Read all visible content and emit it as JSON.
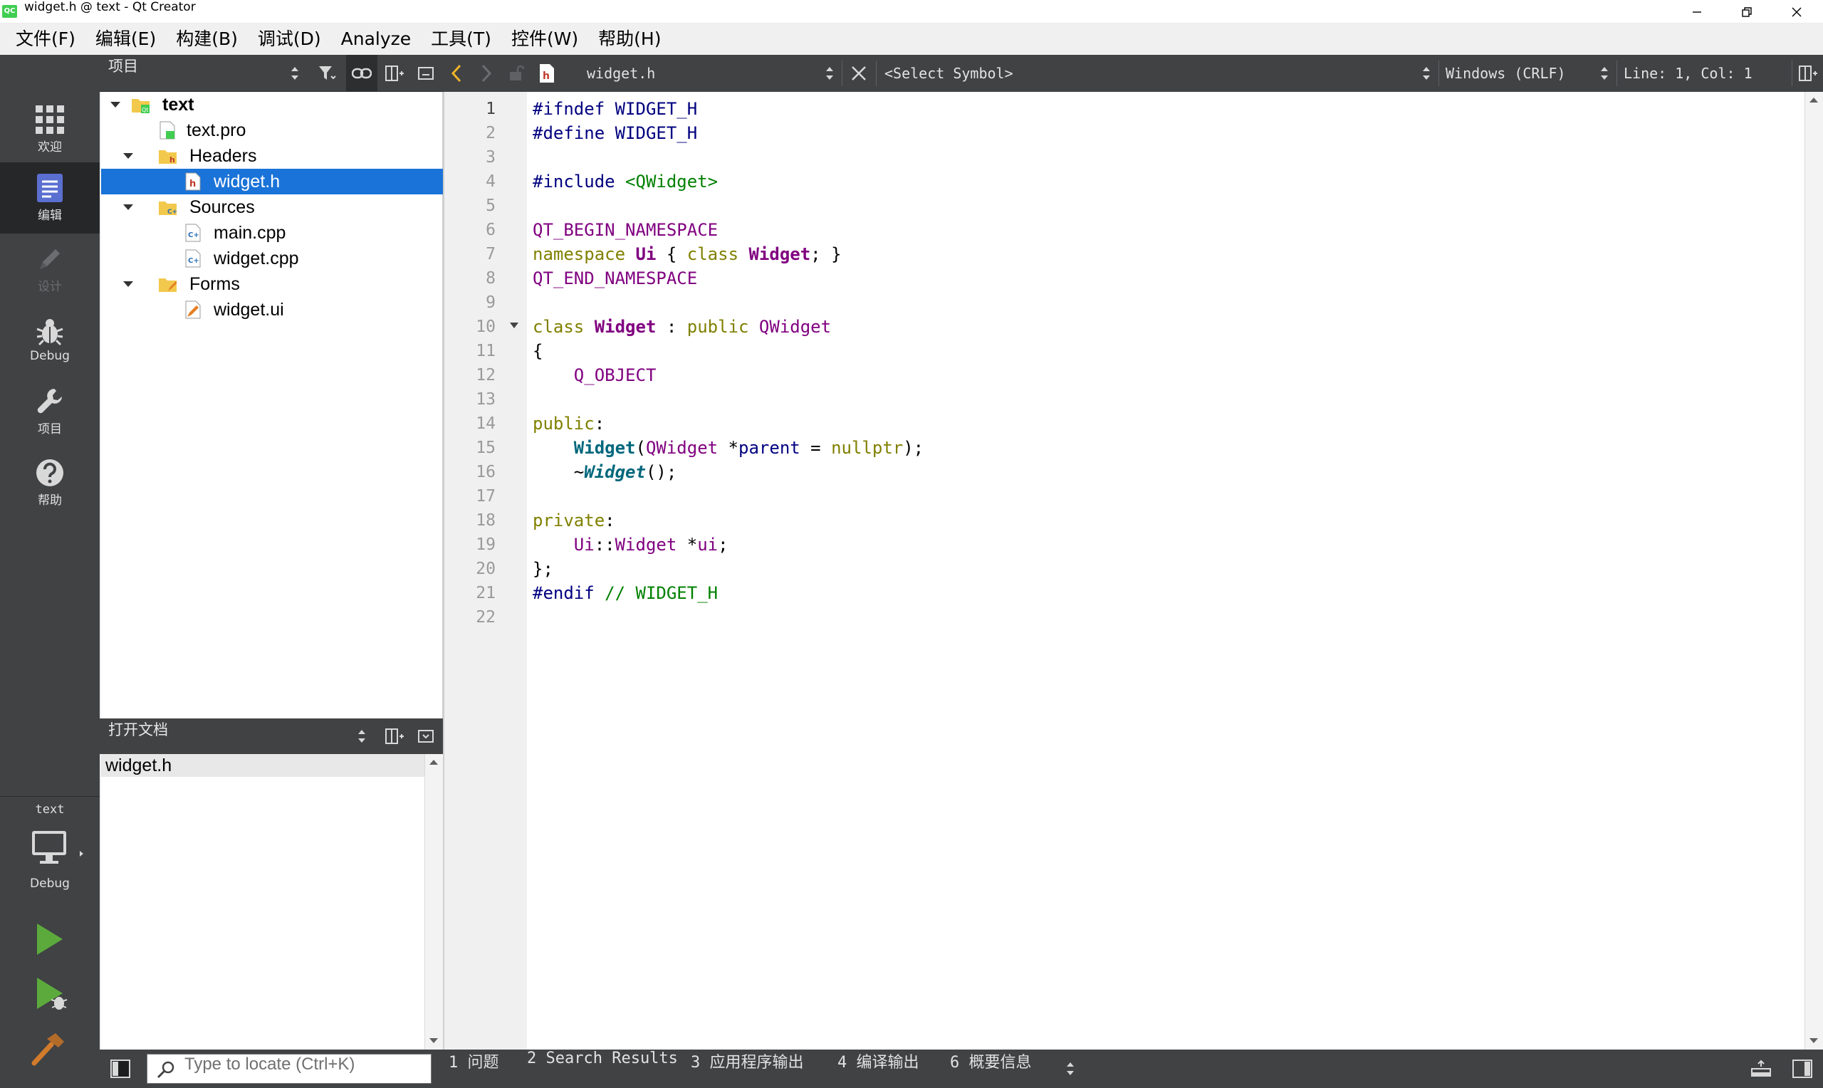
{
  "window": {
    "title": "widget.h @ text - Qt Creator",
    "app_icon_text": "QC"
  },
  "menu": [
    "文件(F)",
    "编辑(E)",
    "构建(B)",
    "调试(D)",
    "Analyze",
    "工具(T)",
    "控件(W)",
    "帮助(H)"
  ],
  "modes": {
    "welcome": "欢迎",
    "edit": "编辑",
    "design": "设计",
    "debug": "Debug",
    "projects": "项目",
    "help": "帮助",
    "kit_project": "text",
    "kit_build": "Debug"
  },
  "project_panel": {
    "title": "项目",
    "tree": {
      "root": "text",
      "pro_file": "text.pro",
      "headers": "Headers",
      "header_file": "widget.h",
      "sources": "Sources",
      "source_main": "main.cpp",
      "source_widget": "widget.cpp",
      "forms": "Forms",
      "form_file": "widget.ui"
    }
  },
  "open_docs": {
    "title": "打开文档",
    "items": [
      "widget.h"
    ]
  },
  "editor_toolbar": {
    "file": "widget.h",
    "symbol": "<Select Symbol>",
    "line_ending": "Windows (CRLF)",
    "position": "Line: 1, Col: 1"
  },
  "editor": {
    "current_line": 1,
    "line_numbers": [
      "1",
      "2",
      "3",
      "4",
      "5",
      "6",
      "7",
      "8",
      "9",
      "10",
      "11",
      "12",
      "13",
      "14",
      "15",
      "16",
      "17",
      "18",
      "19",
      "20",
      "21",
      "22"
    ],
    "code_tokens": {
      "l1": "#ifndef WIDGET_H",
      "l2": "#define WIDGET_H",
      "l4a": "#include ",
      "l4b": "<QWidget>",
      "l6": "QT_BEGIN_NAMESPACE",
      "l7a": "namespace ",
      "l7b": "Ui",
      "l7c": " { ",
      "l7d": "class ",
      "l7e": "Widget",
      "l7f": "; }",
      "l8": "QT_END_NAMESPACE",
      "l10a": "class ",
      "l10b": "Widget",
      "l10c": " : ",
      "l10d": "public ",
      "l10e": "QWidget",
      "l11": "{",
      "l12": "    Q_OBJECT",
      "l14a": "public",
      "l14b": ":",
      "l15a": "    ",
      "l15b": "Widget",
      "l15c": "(",
      "l15d": "QWidget",
      "l15e": " *",
      "l15f": "parent",
      "l15g": " = ",
      "l15h": "nullptr",
      "l15i": ");",
      "l16a": "    ~",
      "l16b": "Widget",
      "l16c": "();",
      "l18a": "private",
      "l18b": ":",
      "l19a": "    ",
      "l19b": "Ui",
      "l19c": "::",
      "l19d": "Widget",
      "l19e": " *",
      "l19f": "ui",
      "l19g": ";",
      "l20": "};",
      "l21a": "#endif",
      "l21b": " // WIDGET_H"
    }
  },
  "statusbar": {
    "locator_placeholder": "Type to locate (Ctrl+K)",
    "tabs": [
      "1  问题",
      "2  Search Results",
      "3  应用程序输出",
      "4  编译输出",
      "6  概要信息"
    ]
  },
  "colors": {
    "sidebar_bg": "#404244",
    "selection": "#1a73d8",
    "keyword": "#808000",
    "preprocessor": "#000080",
    "type": "#800080",
    "comment": "#008000",
    "run_green": "#5caa3c"
  }
}
